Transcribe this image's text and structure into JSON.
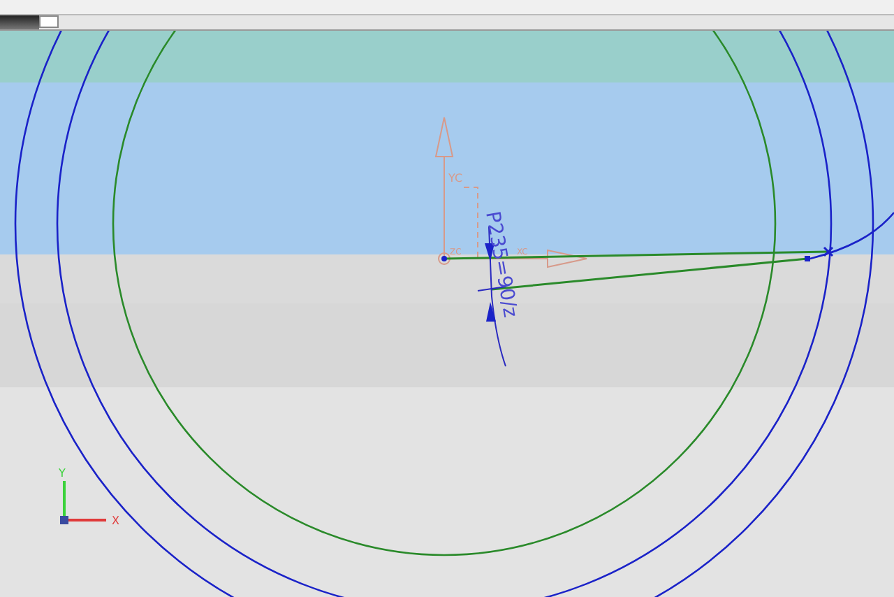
{
  "viewport": {
    "dimension_label": "P235=90/z",
    "wcs_labels": [
      "YC",
      "ZC",
      "XC"
    ],
    "triad_labels": [
      "Y",
      "X"
    ]
  }
}
